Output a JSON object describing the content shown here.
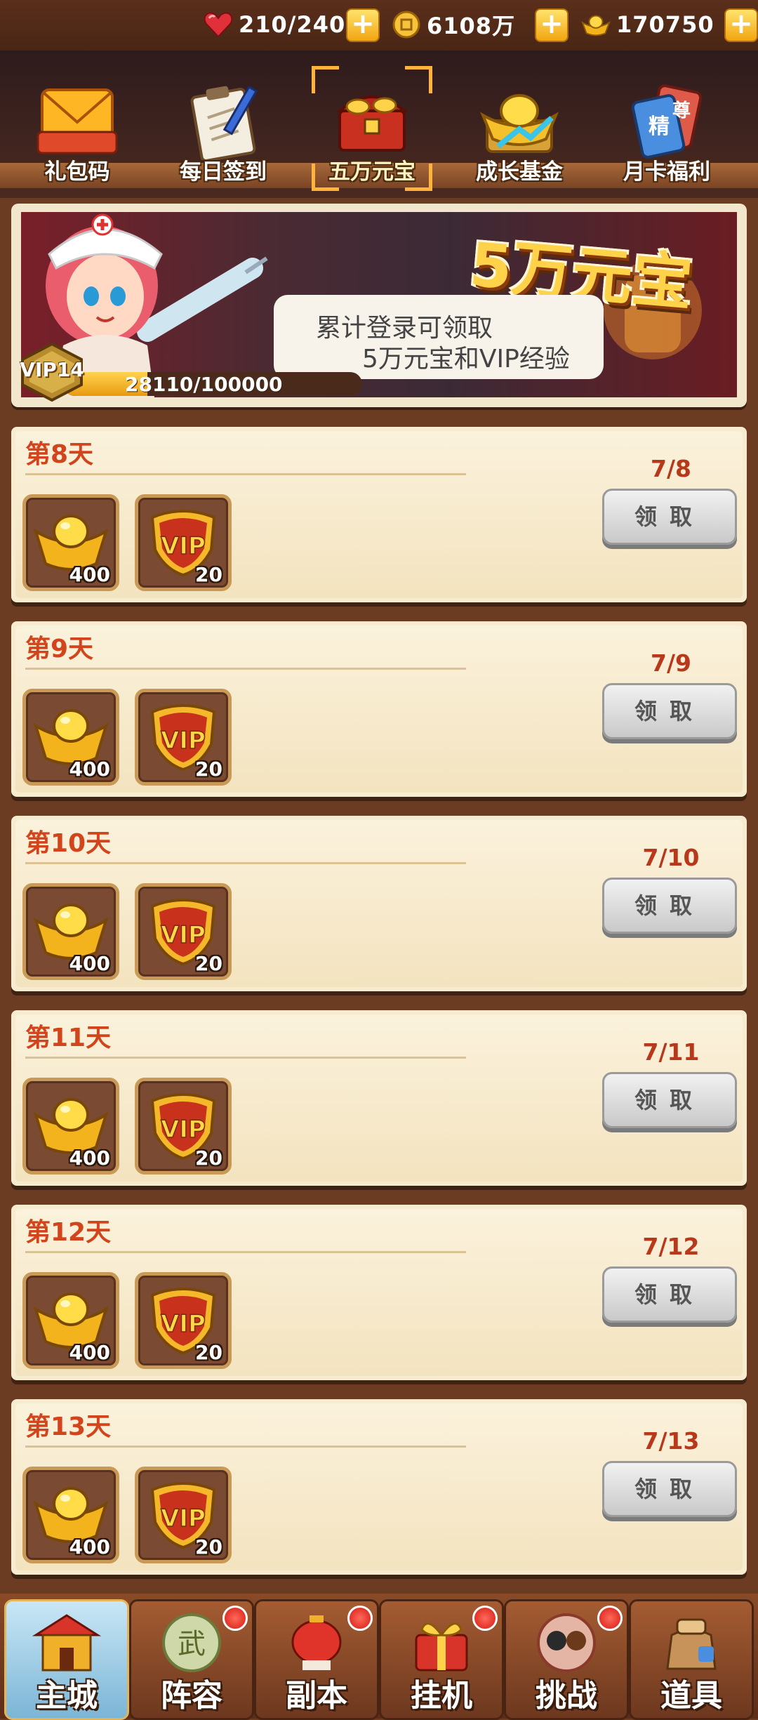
{
  "resources": {
    "stamina": "210/240",
    "coins": "6108万",
    "ingots": "170750"
  },
  "tabs": [
    {
      "label": "礼包码",
      "icon": "envelope-icon"
    },
    {
      "label": "每日签到",
      "icon": "clipboard-icon"
    },
    {
      "label": "五万元宝",
      "icon": "treasure-chest-icon",
      "selected": true
    },
    {
      "label": "成长基金",
      "icon": "gold-ingot-chart-icon"
    },
    {
      "label": "月卡福利",
      "icon": "card-icon"
    }
  ],
  "banner": {
    "title": "5万元宝",
    "line1": "累计登录可领取",
    "line2": "5万元宝和VIP经验",
    "vip_level": "VIP14",
    "progress_text": "28110/100000",
    "progress_fraction": 0.2811
  },
  "rewards": [
    {
      "day": "第8天",
      "ratio": "7/8",
      "claim": "领取",
      "items": [
        {
          "icon": "gold-ingot-icon",
          "qty": "400"
        },
        {
          "icon": "vip-shield-icon",
          "qty": "20"
        }
      ]
    },
    {
      "day": "第9天",
      "ratio": "7/9",
      "claim": "领取",
      "items": [
        {
          "icon": "gold-ingot-icon",
          "qty": "400"
        },
        {
          "icon": "vip-shield-icon",
          "qty": "20"
        }
      ]
    },
    {
      "day": "第10天",
      "ratio": "7/10",
      "claim": "领取",
      "items": [
        {
          "icon": "gold-ingot-icon",
          "qty": "400"
        },
        {
          "icon": "vip-shield-icon",
          "qty": "20"
        }
      ]
    },
    {
      "day": "第11天",
      "ratio": "7/11",
      "claim": "领取",
      "items": [
        {
          "icon": "gold-ingot-icon",
          "qty": "400"
        },
        {
          "icon": "vip-shield-icon",
          "qty": "20"
        }
      ]
    },
    {
      "day": "第12天",
      "ratio": "7/12",
      "claim": "领取",
      "items": [
        {
          "icon": "gold-ingot-icon",
          "qty": "400"
        },
        {
          "icon": "vip-shield-icon",
          "qty": "20"
        }
      ]
    },
    {
      "day": "第13天",
      "ratio": "7/13",
      "claim": "领取",
      "items": [
        {
          "icon": "gold-ingot-icon",
          "qty": "400"
        },
        {
          "icon": "vip-shield-icon",
          "qty": "20"
        }
      ]
    }
  ],
  "nav": [
    {
      "label": "主城",
      "selected": true,
      "badge": false
    },
    {
      "label": "阵容",
      "badge": true
    },
    {
      "label": "副本",
      "badge": true
    },
    {
      "label": "挂机",
      "badge": true
    },
    {
      "label": "挑战",
      "badge": true
    },
    {
      "label": "道具",
      "badge": false
    }
  ],
  "colors": {
    "accent": "#ffb33a",
    "day_title": "#d2451c",
    "ratio": "#b8381b"
  }
}
